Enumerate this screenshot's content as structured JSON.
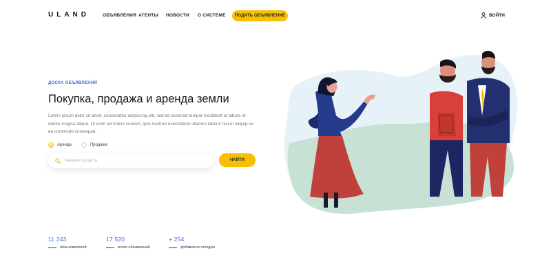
{
  "header": {
    "logo": "ULAND",
    "nav": [
      "ОБЪЯВЛЕНИЯ",
      "АГЕНТЫ",
      "НОВОСТИ",
      "О СИСТЕМЕ"
    ],
    "post_button": "ПОДАТЬ ОБЪЯВЛЕНИЕ",
    "login": "ВОЙТИ"
  },
  "hero": {
    "eyebrow": "ДОСКА ОБЪЯВЛЕНИЙ",
    "title": "Покупка, продажа и аренда земли",
    "description": "Lorem ipsum dolor sit amet, consectetur adipiscing elit, sed do eiusmod tempor incididunt ut labore et dolore magna aliqua. Ut enim ad minim veniam, quis nostrud exercitation ullamco laboris nisi ut aliquip ex ea commodo consequat.",
    "radio_options": [
      "Аренда",
      "Продажа"
    ],
    "selected_option": "Аренда",
    "search_placeholder": "Введите область",
    "search_button": "НАЙТИ"
  },
  "stats": [
    {
      "value": "11 243",
      "label": "пользователей"
    },
    {
      "value": "17 520",
      "label": "всего объявлений"
    },
    {
      "value": "+ 254",
      "label": "добавлено сегодня"
    }
  ],
  "colors": {
    "accent": "#f8c000",
    "link_blue": "#3d6fd8",
    "text": "#151515"
  }
}
